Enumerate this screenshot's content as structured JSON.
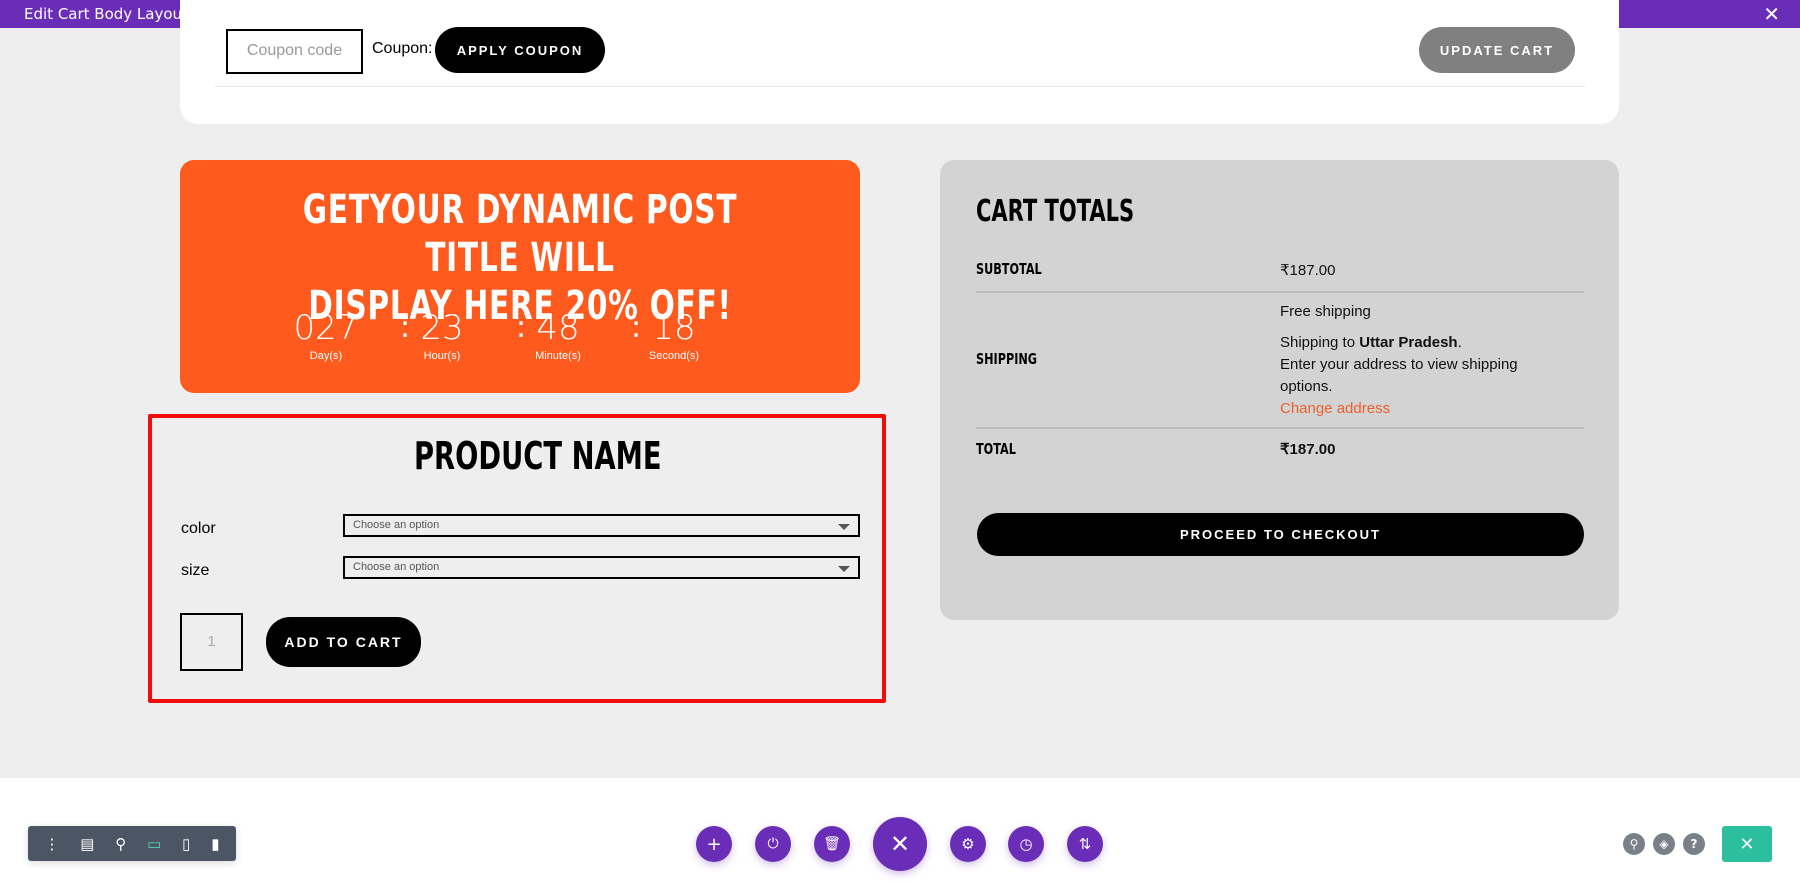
{
  "window": {
    "title": "Edit Cart Body Layout",
    "close_icon": "close-icon"
  },
  "coupon": {
    "placeholder": "Coupon code",
    "label": "Coupon:",
    "apply_label": "APPLY COUPON",
    "update_label": "UPDATE CART"
  },
  "promo": {
    "title_line1": "GETYOUR DYNAMIC POST TITLE WILL",
    "title_line2": "DISPLAY HERE 20% OFF!",
    "countdown": [
      {
        "value": "027",
        "label": "Day(s)"
      },
      {
        "value": "23",
        "label": "Hour(s)"
      },
      {
        "value": "48",
        "label": "Minute(s)"
      },
      {
        "value": "18",
        "label": "Second(s)"
      }
    ],
    "separator": ":",
    "color": "#fe5a1d"
  },
  "product": {
    "name": "PRODUCT NAME",
    "attributes": [
      {
        "label": "color",
        "value": "Choose an option"
      },
      {
        "label": "size",
        "value": "Choose an option"
      }
    ],
    "quantity": "1",
    "add_to_cart_label": "ADD TO CART",
    "highlight_color": "#f20c0c"
  },
  "totals": {
    "title": "CART TOTALS",
    "subtotal_label": "SUBTOTAL",
    "subtotal_value": "₹187.00",
    "shipping_label": "SHIPPING",
    "shipping_method": "Free shipping",
    "shipping_to_prefix": "Shipping to ",
    "shipping_region": "Uttar Pradesh",
    "shipping_to_suffix": ".",
    "shipping_note": "Enter your address to view shipping options.",
    "change_address": "Change address",
    "total_label": "TOTAL",
    "total_value": "₹187.00",
    "checkout_label": "PROCEED TO CHECKOUT"
  },
  "builder": {
    "accent": "#6a2db8",
    "left_toolbar": [
      "more-icon",
      "wireframe-icon",
      "zoom-icon",
      "desktop-icon",
      "tablet-icon",
      "phone-icon"
    ],
    "center_buttons": [
      "add-icon",
      "power-icon",
      "trash-icon",
      "close-icon",
      "gear-icon",
      "history-icon",
      "sort-icon"
    ],
    "right_buttons": [
      "search-icon",
      "layers-icon",
      "help-icon"
    ],
    "exit_color": "#2bbf9d"
  }
}
